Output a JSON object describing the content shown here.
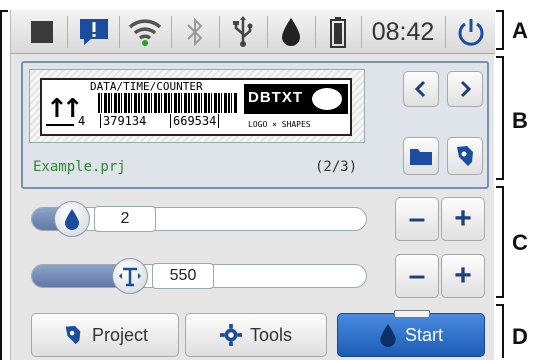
{
  "status": {
    "icons": [
      "stop-icon",
      "message-alert-icon",
      "wifi-icon",
      "bluetooth-icon",
      "usb-icon",
      "ink-drop-icon",
      "battery-icon",
      "power-icon"
    ],
    "time": "08:42"
  },
  "preview": {
    "top_text": "DATA/TIME/COUNTER",
    "barcode_num_prefix": "4",
    "barcode_num_1": "379134",
    "barcode_num_2": "669534",
    "logo_text": "DBTXT",
    "logo_caption": "LOGO × SHAPES",
    "arrow_symbol": "↑↑"
  },
  "project": {
    "filename": "Example.prj",
    "counter": "(2/3)"
  },
  "sliders": [
    {
      "name": "ink-drop",
      "value": "2",
      "level": 0.02
    },
    {
      "name": "font-size",
      "value": "550",
      "level": 0.33
    }
  ],
  "bottom": {
    "project_label": "Project",
    "tools_label": "Tools",
    "start_label": "Start"
  },
  "sections": [
    "A",
    "B",
    "C",
    "D"
  ],
  "colors": {
    "accent": "#1c5cb6",
    "file": "#2e8b2e",
    "dark_blue": "#1f3f7a"
  }
}
